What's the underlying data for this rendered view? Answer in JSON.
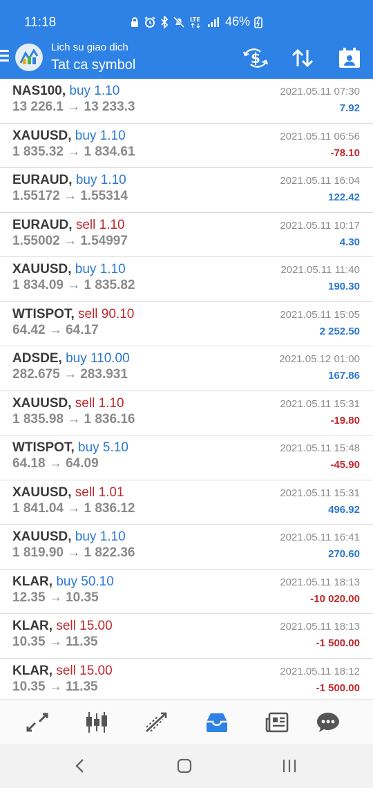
{
  "status_bar": {
    "time": "11:18",
    "battery": "46%",
    "network": "LTE"
  },
  "toolbar": {
    "subtitle": "Lich su giao dich",
    "title": "Tat ca symbol",
    "icons": [
      "menu-icon",
      "app-logo",
      "currency-exchange-icon",
      "sort-icon",
      "calendar-icon"
    ]
  },
  "trades": [
    {
      "symbol": "NAS100,",
      "side": "buy",
      "side_label": "buy 1.10",
      "prices": "13 226.1 → 13 233.3",
      "date": "2021.05.11 07:30",
      "profit": "7.92",
      "profit_sign": "pos"
    },
    {
      "symbol": "XAUUSD,",
      "side": "buy",
      "side_label": "buy 1.10",
      "prices": "1 835.32 → 1 834.61",
      "date": "2021.05.11 06:56",
      "profit": "-78.10",
      "profit_sign": "neg"
    },
    {
      "symbol": "EURAUD,",
      "side": "buy",
      "side_label": "buy 1.10",
      "prices": "1.55172 → 1.55314",
      "date": "2021.05.11 16:04",
      "profit": "122.42",
      "profit_sign": "pos"
    },
    {
      "symbol": "EURAUD,",
      "side": "sell",
      "side_label": "sell 1.10",
      "prices": "1.55002 → 1.54997",
      "date": "2021.05.11 10:17",
      "profit": "4.30",
      "profit_sign": "pos"
    },
    {
      "symbol": "XAUUSD,",
      "side": "buy",
      "side_label": "buy 1.10",
      "prices": "1 834.09 → 1 835.82",
      "date": "2021.05.11 11:40",
      "profit": "190.30",
      "profit_sign": "pos"
    },
    {
      "symbol": "WTISPOT,",
      "side": "sell",
      "side_label": "sell 90.10",
      "prices": "64.42 → 64.17",
      "date": "2021.05.11 15:05",
      "profit": "2 252.50",
      "profit_sign": "pos"
    },
    {
      "symbol": "ADSDE,",
      "side": "buy",
      "side_label": "buy 110.00",
      "prices": "282.675 → 283.931",
      "date": "2021.05.12 01:00",
      "profit": "167.86",
      "profit_sign": "pos"
    },
    {
      "symbol": "XAUUSD,",
      "side": "sell",
      "side_label": "sell 1.10",
      "prices": "1 835.98 → 1 836.16",
      "date": "2021.05.11 15:31",
      "profit": "-19.80",
      "profit_sign": "neg"
    },
    {
      "symbol": "WTISPOT,",
      "side": "buy",
      "side_label": "buy 5.10",
      "prices": "64.18 → 64.09",
      "date": "2021.05.11 15:48",
      "profit": "-45.90",
      "profit_sign": "neg"
    },
    {
      "symbol": "XAUUSD,",
      "side": "sell",
      "side_label": "sell 1.01",
      "prices": "1 841.04 → 1 836.12",
      "date": "2021.05.11 15:31",
      "profit": "496.92",
      "profit_sign": "pos"
    },
    {
      "symbol": "XAUUSD,",
      "side": "buy",
      "side_label": "buy 1.10",
      "prices": "1 819.90 → 1 822.36",
      "date": "2021.05.11 16:41",
      "profit": "270.60",
      "profit_sign": "pos"
    },
    {
      "symbol": "KLAR,",
      "side": "buy",
      "side_label": "buy 50.10",
      "prices": "12.35 → 10.35",
      "date": "2021.05.11 18:13",
      "profit": "-10 020.00",
      "profit_sign": "neg"
    },
    {
      "symbol": "KLAR,",
      "side": "sell",
      "side_label": "sell 15.00",
      "prices": "10.35 → 11.35",
      "date": "2021.05.11 18:13",
      "profit": "-1 500.00",
      "profit_sign": "neg"
    },
    {
      "symbol": "KLAR,",
      "side": "sell",
      "side_label": "sell 15.00",
      "prices": "10.35 → 11.35",
      "date": "2021.05.11 18:12",
      "profit": "-1 500.00",
      "profit_sign": "neg"
    }
  ],
  "tabbar": {
    "tabs": [
      "quotes-icon",
      "chart-icon",
      "trade-icon",
      "history-icon",
      "news-icon",
      "chat-icon"
    ],
    "active": "history-icon",
    "active_color": "#2e82e6",
    "inactive_color": "#555555"
  },
  "colors": {
    "header": "#2e82e6",
    "buy": "#2a78d0",
    "sell": "#c0282c"
  }
}
